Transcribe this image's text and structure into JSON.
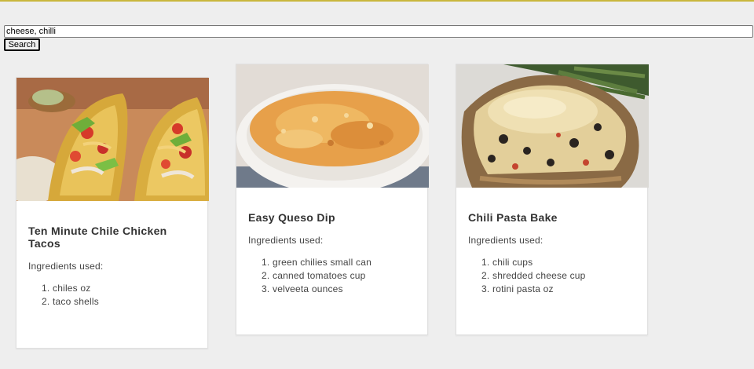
{
  "search": {
    "value": "cheese, chilli",
    "button_label": "Search"
  },
  "recipes": [
    {
      "title": "Ten Minute Chile Chicken Tacos",
      "ingredients_label": "Ingredients used:",
      "ingredients": [
        "chiles oz",
        "taco shells"
      ]
    },
    {
      "title": "Easy Queso Dip",
      "ingredients_label": "Ingredients used:",
      "ingredients": [
        "green chilies small can",
        "canned tomatoes cup",
        "velveeta ounces"
      ]
    },
    {
      "title": "Chili Pasta Bake",
      "ingredients_label": "Ingredients used:",
      "ingredients": [
        "chili cups",
        "shredded cheese cup",
        "rotini pasta oz"
      ]
    }
  ],
  "colors": {
    "background": "#eeeeee",
    "top_border": "#c9b63c",
    "card_background": "#ffffff"
  }
}
